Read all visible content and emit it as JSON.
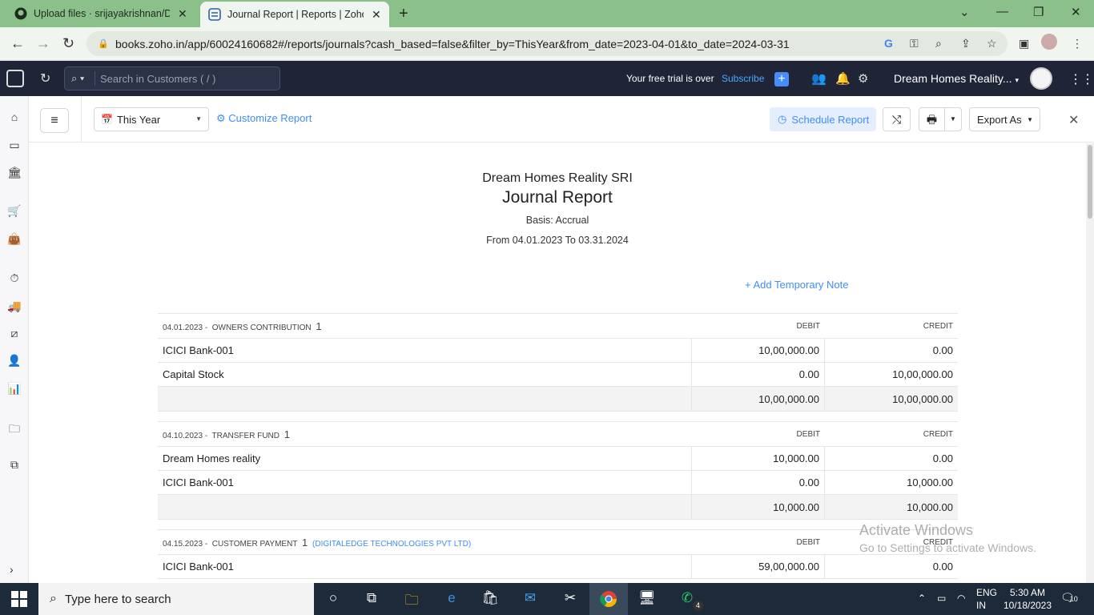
{
  "browser": {
    "tabs": [
      {
        "title": "Upload files · srijayakrishnan/DR",
        "active": false
      },
      {
        "title": "Journal Report | Reports | Zoho B",
        "active": true
      }
    ],
    "url": "books.zoho.in/app/60024160682#/reports/journals?cash_based=false&filter_by=ThisYear&from_date=2023-04-01&to_date=2024-03-31"
  },
  "header": {
    "search_placeholder": "Search in Customers ( / )",
    "trial_text": "Your free trial is over",
    "subscribe_label": "Subscribe",
    "org_name": "Dream Homes Reality..."
  },
  "toolbar": {
    "period": "This Year",
    "customize_label": "Customize Report",
    "schedule_label": "Schedule Report",
    "export_label": "Export As"
  },
  "report": {
    "org": "Dream Homes Reality SRI",
    "title": "Journal Report",
    "basis": "Basis: Accrual",
    "range": "From 04.01.2023 To 03.31.2024",
    "add_note_label": "Add Temporary Note",
    "debit_header": "DEBIT",
    "credit_header": "CREDIT",
    "journals": [
      {
        "date": "04.01.2023",
        "type": "OWNERS CONTRIBUTION",
        "num": "1",
        "customer": "",
        "rows": [
          {
            "account": "ICICI Bank-001",
            "debit": "10,00,000.00",
            "credit": "0.00"
          },
          {
            "account": "Capital Stock",
            "debit": "0.00",
            "credit": "10,00,000.00"
          }
        ],
        "total_debit": "10,00,000.00",
        "total_credit": "10,00,000.00"
      },
      {
        "date": "04.10.2023",
        "type": "TRANSFER FUND",
        "num": "1",
        "customer": "",
        "rows": [
          {
            "account": "Dream Homes reality",
            "debit": "10,000.00",
            "credit": "0.00"
          },
          {
            "account": "ICICI Bank-001",
            "debit": "0.00",
            "credit": "10,000.00"
          }
        ],
        "total_debit": "10,000.00",
        "total_credit": "10,000.00"
      },
      {
        "date": "04.15.2023",
        "type": "CUSTOMER PAYMENT",
        "num": "1",
        "customer": "(DIGITALEDGE TECHNOLOGIES PVT LTD)",
        "rows": [
          {
            "account": "ICICI Bank-001",
            "debit": "59,00,000.00",
            "credit": "0.00"
          }
        ]
      }
    ]
  },
  "watermark": {
    "line1": "Activate Windows",
    "line2": "Go to Settings to activate Windows."
  },
  "taskbar": {
    "search_placeholder": "Type here to search",
    "whatsapp_badge": "4",
    "lang_line1": "ENG",
    "lang_line2": "IN",
    "time": "5:30 AM",
    "date": "10/18/2023",
    "notif_count": "10"
  }
}
